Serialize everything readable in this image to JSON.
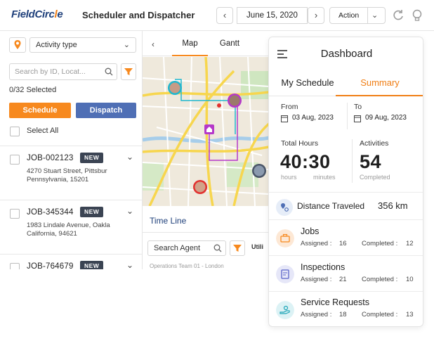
{
  "header": {
    "logo": {
      "text_main": "FieldCirc",
      "text_o": "l",
      "text_end": "e"
    },
    "app_title": "Scheduler and Dispatcher",
    "date": "June 15, 2020",
    "action_label": "Action",
    "prev_icon": "chevron-left-icon",
    "next_icon": "chevron-right-icon"
  },
  "sidebar": {
    "activity_type": "Activity type",
    "search_placeholder": "Search by ID, Locat...",
    "selected_text": "0/32 Selected",
    "schedule_label": "Schedule",
    "dispatch_label": "Dispatch",
    "select_all_label": "Select All",
    "jobs": [
      {
        "id": "JOB-002123",
        "badge": "NEW",
        "address_1": "4270 Stuart Street, Pittsbur",
        "address_2": "Pennsylvania, 15201"
      },
      {
        "id": "JOB-345344",
        "badge": "NEW",
        "address_1": "1983 Lindale Avenue, Oakla",
        "address_2": "California, 94621"
      },
      {
        "id": "JOB-764679",
        "badge": "NEW",
        "address_1": "",
        "address_2": ""
      }
    ]
  },
  "map_panel": {
    "tabs": [
      "Map",
      "Gantt"
    ],
    "timeline_label": "Time Line",
    "agent_search_label": "Search Agent",
    "utilization_label": "Utili",
    "ops_team_text": "Operations Team 01 - London"
  },
  "dashboard": {
    "title": "Dashboard",
    "tabs": {
      "my_schedule": "My Schedule",
      "summary": "Summary"
    },
    "from_label": "From",
    "from_date": "03 Aug, 2023",
    "to_label": "To",
    "to_date": "09 Aug, 2023",
    "total_hours_label": "Total Hours",
    "hours_value": "40:30",
    "hours_unit": "hours",
    "minutes_unit": "minutes",
    "activities_label": "Activities",
    "activities_value": "54",
    "activities_sub": "Completed",
    "distance_label": "Distance Traveled",
    "distance_value": "356 km",
    "rows": [
      {
        "title": "Jobs",
        "assigned_label": "Assigned :",
        "assigned": "16",
        "completed_label": "Completed :",
        "completed": "12",
        "icon": "briefcase-icon",
        "color": "#f7891e"
      },
      {
        "title": "Inspections",
        "assigned_label": "Assigned :",
        "assigned": "21",
        "completed_label": "Completed :",
        "completed": "10",
        "icon": "inspection-icon",
        "color": "#5a63c8"
      },
      {
        "title": "Service Requests",
        "assigned_label": "Assigned :",
        "assigned": "18",
        "completed_label": "Completed :",
        "completed": "13",
        "icon": "service-hand-icon",
        "color": "#1fa6b8"
      }
    ]
  },
  "colors": {
    "accent_orange": "#f7891e",
    "dispatch_blue": "#4f6fb5",
    "brand_navy": "#1e3f7a"
  }
}
